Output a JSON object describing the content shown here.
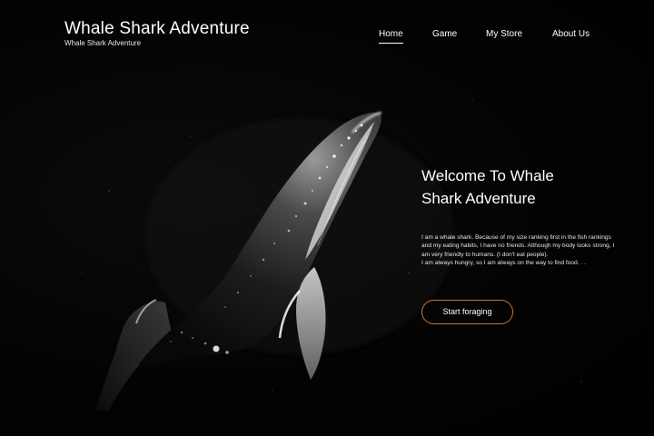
{
  "brand": {
    "title": "Whale Shark Adventure",
    "subtitle": "Whale Shark Adventure"
  },
  "nav": {
    "items": [
      {
        "label": "Home",
        "active": true
      },
      {
        "label": "Game",
        "active": false
      },
      {
        "label": "My Store",
        "active": false
      },
      {
        "label": "About Us",
        "active": false
      }
    ]
  },
  "hero": {
    "heading_line1": "Welcome To Whale",
    "heading_line2": "Shark Adventure",
    "paragraph1": "I am a whale shark. Because of my size ranking first in the fish rankings and my eating habits, I have no friends. Although my body looks strong, I am very friendly to humans. (I don't eat people).",
    "paragraph2": "I am always hungry, so I am always on the way to find food. . .",
    "cta_label": "Start foraging"
  },
  "colors": {
    "background": "#000000",
    "text": "#ffffff",
    "cta_border": "#c3773a"
  },
  "icons": {
    "hero_image": "whale-illustration"
  }
}
